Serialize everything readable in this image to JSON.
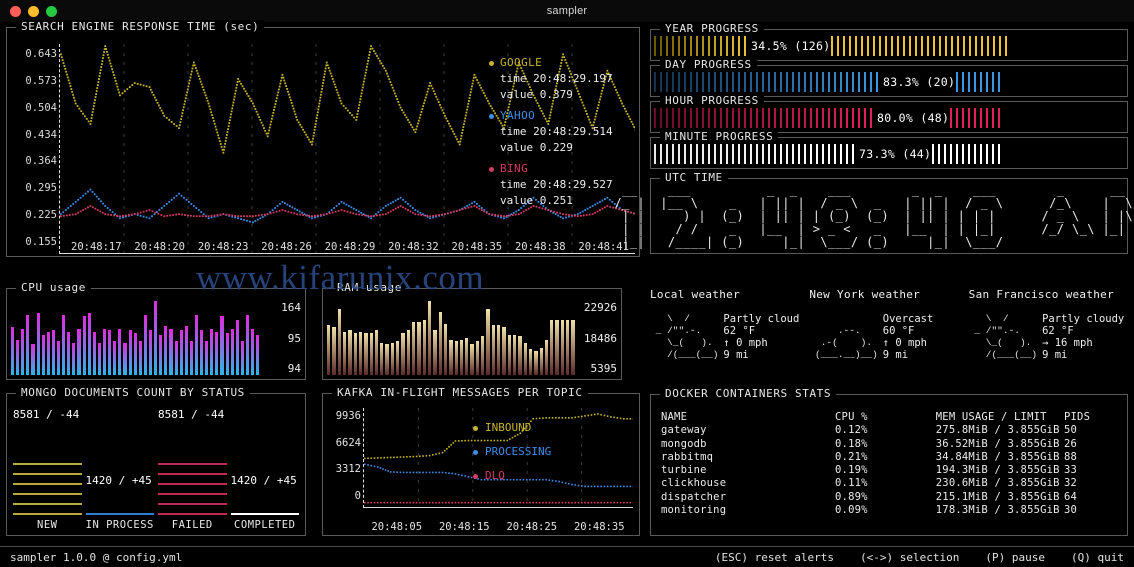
{
  "window": {
    "title": "sampler",
    "buttons": [
      "close",
      "minimize",
      "maximize"
    ]
  },
  "runchart": {
    "title": "SEARCH ENGINE RESPONSE TIME (sec)",
    "y_ticks": [
      "0.643",
      "0.573",
      "0.504",
      "0.434",
      "0.364",
      "0.295",
      "0.225",
      "0.155"
    ],
    "x_ticks": [
      "20:48:17",
      "20:48:20",
      "20:48:23",
      "20:48:26",
      "20:48:29",
      "20:48:32",
      "20:48:35",
      "20:48:38",
      "20:48:41"
    ],
    "series": [
      {
        "name": "GOOGLE",
        "color": "#c8b42a",
        "time": "20:48:29.197",
        "value": "0.379",
        "time_label": "time",
        "value_label": "value"
      },
      {
        "name": "YAHOO",
        "color": "#3b8eea",
        "time": "20:48:29.514",
        "value": "0.229",
        "time_label": "time",
        "value_label": "value"
      },
      {
        "name": "BING",
        "color": "#d63b63",
        "time": "20:48:29.527",
        "value": "0.251",
        "time_label": "time",
        "value_label": "value"
      }
    ]
  },
  "gauges": [
    {
      "id": "year",
      "title": "YEAR PROGRESS",
      "text": "34.5% (126)",
      "percent": 34.5,
      "color_start": "#6b5b00",
      "color_end": "#e8c233"
    },
    {
      "id": "day",
      "title": "DAY PROGRESS",
      "text": "83.3% (20)",
      "percent": 83.3,
      "color_start": "#13324f",
      "color_end": "#3b97e0"
    },
    {
      "id": "hour",
      "title": "HOUR PROGRESS",
      "text": "80.0% (48)",
      "percent": 80.0,
      "color_start": "#6b0d2a",
      "color_end": "#e51e5e"
    },
    {
      "id": "minute",
      "title": "MINUTE PROGRESS",
      "text": "73.3% (44)",
      "percent": 73.3,
      "color_start": "#e8e8e8",
      "color_end": "#ffffff"
    }
  ],
  "clock": {
    "title": "UTC TIME",
    "time": "12:48:40 AM",
    "ascii": "  __   ___         _  _     _ _   ___      ___  ___ \n / /  |_  )  ___  | || |   (_) | / _ \\    / \\ |  \\/  |\n/ /_   / /  |___| |__   _| | |( (_) )  / _ \\| |\\/| |\n|_( )|/___|   o     |_|   |_| \\___/  /_/ \\_\\_|  |_|"
  },
  "cpu": {
    "title": "CPU usage",
    "labels": [
      "164",
      "95",
      "94"
    ],
    "values": [
      62,
      46,
      60,
      78,
      40,
      80,
      52,
      56,
      58,
      44,
      78,
      56,
      42,
      60,
      76,
      80,
      56,
      42,
      60,
      58,
      44,
      60,
      42,
      58,
      54,
      44,
      78,
      58,
      96,
      52,
      64,
      60,
      44,
      58,
      64,
      44,
      78,
      58,
      44,
      60,
      56,
      76,
      54,
      60,
      72,
      44,
      78,
      60,
      52
    ],
    "color_bottom": "#2ab7ea",
    "color_top": "#e02be0"
  },
  "ram": {
    "title": "RAM usage",
    "labels": [
      "22926",
      "18486",
      "5395"
    ],
    "values": [
      62,
      60,
      82,
      54,
      56,
      52,
      54,
      52,
      52,
      56,
      40,
      38,
      40,
      42,
      52,
      56,
      66,
      66,
      68,
      92,
      56,
      78,
      64,
      44,
      42,
      44,
      46,
      38,
      42,
      48,
      82,
      62,
      62,
      60,
      50,
      50,
      48,
      40,
      32,
      30,
      34,
      44,
      68,
      68,
      68,
      68,
      68
    ],
    "color_bottom": "#5a2a2a",
    "color_top": "#efe0a8"
  },
  "mongo": {
    "title": "MONGO DOCUMENTS COUNT BY STATUS",
    "columns": [
      {
        "label": "NEW",
        "value": "8581 / -44",
        "color": "#b9a93a",
        "bars": 6,
        "value_top": 0
      },
      {
        "label": "IN PROCESS",
        "value": "1420 / +45",
        "color": "#2f7fd0",
        "bars": 1,
        "value_top": 66
      },
      {
        "label": "FAILED",
        "value": "8581 / -44",
        "color": "#c02a50",
        "bars": 6,
        "value_top": 0
      },
      {
        "label": "COMPLETED",
        "value": "1420 / +45",
        "color": "#ffffff",
        "bars": 1,
        "value_top": 66
      }
    ]
  },
  "kafka": {
    "title": "KAFKA IN-FLIGHT MESSAGES PER TOPIC",
    "y_ticks": [
      "9936",
      "6624",
      "3312",
      "0"
    ],
    "x_ticks": [
      "20:48:05",
      "20:48:15",
      "20:48:25",
      "20:48:35"
    ],
    "series": [
      {
        "name": "INBOUND",
        "color": "#c8b42a"
      },
      {
        "name": "PROCESSING",
        "color": "#3b8eea"
      },
      {
        "name": "DLQ",
        "color": "#d63b63"
      }
    ]
  },
  "weather": [
    {
      "title": "Local weather",
      "art": "   \\  /\n _ /\"\".-.\n   \\_(   ).\n   /(___(__)",
      "condition": "Partly cloud",
      "temperature": "62 °F",
      "wind": "↑ 0 mph",
      "visibility": "9 mi"
    },
    {
      "title": "New York weather",
      "art": "\n     .--.\n  .-(    ).\n (___.__)__)",
      "condition": "Overcast",
      "temperature": "60 °F",
      "wind": "↑ 0 mph",
      "visibility": "9 mi"
    },
    {
      "title": "San Francisco weather",
      "art": "   \\  /\n _ /\"\".-.\n   \\_(   ).\n   /(___(__)",
      "condition": "Partly cloudy",
      "temperature": "62 °F",
      "wind": "→ 16 mph",
      "visibility": "9 mi"
    }
  ],
  "docker": {
    "title": "DOCKER CONTAINERS STATS",
    "headers": [
      "NAME",
      "CPU %",
      "MEM USAGE / LIMIT",
      "PIDS"
    ],
    "rows": [
      [
        "gateway",
        "0.12%",
        "275.8MiB / 3.855GiB",
        "50"
      ],
      [
        "mongodb",
        "0.18%",
        "36.52MiB / 3.855GiB",
        "26"
      ],
      [
        "rabbitmq",
        "0.21%",
        "34.84MiB / 3.855GiB",
        "88"
      ],
      [
        "turbine",
        "0.19%",
        "194.3MiB / 3.855GiB",
        "33"
      ],
      [
        "clickhouse",
        "0.11%",
        "230.6MiB / 3.855GiB",
        "32"
      ],
      [
        "dispatcher",
        "0.89%",
        "215.1MiB / 3.855GiB",
        "64"
      ],
      [
        "monitoring",
        "0.09%",
        "178.3MiB / 3.855GiB",
        "30"
      ]
    ]
  },
  "statusbar": {
    "left": "sampler 1.0.0 @ config.yml",
    "shortcuts": [
      "(ESC) reset alerts",
      "(<->) selection",
      "(P) pause",
      "(Q) quit"
    ]
  },
  "watermark": "www.kifarunix.com",
  "chart_data": [
    {
      "type": "line",
      "title": "SEARCH ENGINE RESPONSE TIME (sec)",
      "xlabel": "",
      "ylabel": "sec",
      "ylim": [
        0.155,
        0.643
      ],
      "x": [
        "20:48:17",
        "20:48:20",
        "20:48:23",
        "20:48:26",
        "20:48:29",
        "20:48:32",
        "20:48:35",
        "20:48:38",
        "20:48:41"
      ],
      "series": [
        {
          "name": "GOOGLE",
          "color": "#c8b42a",
          "values": [
            0.62,
            0.5,
            0.45,
            0.64,
            0.52,
            0.55,
            0.54,
            0.47,
            0.44,
            0.6,
            0.5,
            0.38,
            0.56,
            0.5,
            0.42,
            0.57,
            0.46,
            0.4,
            0.6,
            0.5,
            0.46,
            0.64,
            0.58,
            0.49,
            0.43,
            0.55,
            0.47,
            0.4,
            0.57,
            0.5,
            0.44,
            0.6,
            0.52,
            0.45,
            0.62,
            0.53,
            0.44,
            0.58,
            0.5,
            0.43
          ]
        },
        {
          "name": "YAHOO",
          "color": "#3b8eea",
          "values": [
            0.23,
            0.26,
            0.29,
            0.25,
            0.22,
            0.23,
            0.22,
            0.25,
            0.28,
            0.25,
            0.22,
            0.23,
            0.22,
            0.21,
            0.23,
            0.26,
            0.24,
            0.22,
            0.23,
            0.26,
            0.24,
            0.22,
            0.25,
            0.27,
            0.24,
            0.22,
            0.23,
            0.24,
            0.26,
            0.23,
            0.22,
            0.24,
            0.27,
            0.24,
            0.22,
            0.23,
            0.25,
            0.27,
            0.24,
            0.23
          ]
        },
        {
          "name": "BING",
          "color": "#d63b63",
          "values": [
            0.225,
            0.23,
            0.25,
            0.23,
            0.225,
            0.23,
            0.24,
            0.225,
            0.23,
            0.225,
            0.225,
            0.23,
            0.225,
            0.225,
            0.23,
            0.24,
            0.23,
            0.225,
            0.23,
            0.24,
            0.23,
            0.225,
            0.23,
            0.25,
            0.23,
            0.225,
            0.23,
            0.24,
            0.25,
            0.23,
            0.225,
            0.23,
            0.25,
            0.24,
            0.23,
            0.225,
            0.23,
            0.25,
            0.24,
            0.23
          ]
        }
      ],
      "legend_position": "right",
      "grid": true
    },
    {
      "type": "line",
      "title": "KAFKA IN-FLIGHT MESSAGES PER TOPIC",
      "xlabel": "",
      "ylabel": "",
      "ylim": [
        0,
        9936
      ],
      "x": [
        "20:48:05",
        "20:48:15",
        "20:48:25",
        "20:48:35"
      ],
      "series": [
        {
          "name": "INBOUND",
          "color": "#c8b42a",
          "values": [
            4800,
            4850,
            4900,
            4950,
            5000,
            5100,
            5400,
            6600,
            6650,
            6650,
            6650,
            6650,
            7400,
            8900,
            9000,
            9000,
            9000,
            9200,
            9400,
            9100,
            8900,
            8900
          ]
        },
        {
          "name": "PROCESSING",
          "color": "#3b8eea",
          "values": [
            4200,
            3900,
            3400,
            3350,
            3350,
            3350,
            3350,
            3200,
            2900,
            2600,
            2600,
            2600,
            2600,
            2600,
            2600,
            2400,
            2100,
            1900,
            1900,
            1900,
            1900,
            1900
          ]
        },
        {
          "name": "DLQ",
          "color": "#d63b63",
          "values": [
            220,
            220,
            220,
            220,
            220,
            220,
            220,
            220,
            220,
            220,
            220,
            220,
            220,
            220,
            220,
            220,
            220,
            220,
            220,
            220,
            220,
            220
          ]
        }
      ],
      "legend_position": "center",
      "grid": true
    },
    {
      "type": "bar",
      "title": "CPU usage",
      "categories": [],
      "values": [
        62,
        46,
        60,
        78,
        40,
        80,
        52,
        56,
        58,
        44,
        78,
        56,
        42,
        60,
        76,
        80,
        56,
        42,
        60,
        58,
        44,
        60,
        42,
        58,
        54,
        44,
        78,
        58,
        96,
        52,
        64,
        60,
        44,
        58,
        64,
        44,
        78,
        58,
        44,
        60,
        56,
        76,
        54,
        60,
        72,
        44,
        78,
        60,
        52
      ],
      "axis_labels": [
        "164",
        "95",
        "94"
      ],
      "ylim": [
        0,
        164
      ]
    },
    {
      "type": "bar",
      "title": "RAM usage",
      "categories": [],
      "values": [
        62,
        60,
        82,
        54,
        56,
        52,
        54,
        52,
        52,
        56,
        40,
        38,
        40,
        42,
        52,
        56,
        66,
        66,
        68,
        92,
        56,
        78,
        64,
        44,
        42,
        44,
        46,
        38,
        42,
        48,
        82,
        62,
        62,
        60,
        50,
        50,
        48,
        40,
        32,
        30,
        34,
        44,
        68,
        68,
        68,
        68,
        68
      ],
      "axis_labels": [
        "22926",
        "18486",
        "5395"
      ],
      "ylim": [
        0,
        22926
      ]
    }
  ]
}
